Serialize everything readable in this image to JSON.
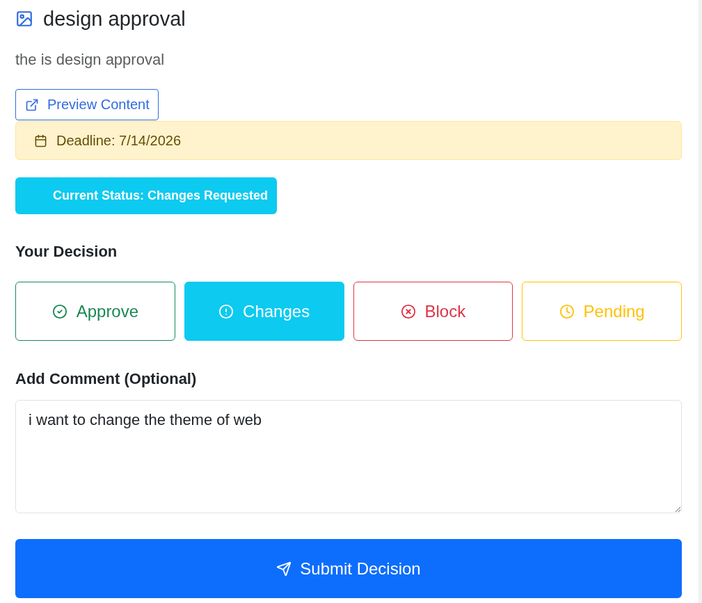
{
  "header": {
    "title": "design approval",
    "description": "the is design approval"
  },
  "preview_button": {
    "label": "Preview Content"
  },
  "deadline": {
    "text": "Deadline: 7/14/2026"
  },
  "status": {
    "text": "Current Status: Changes Requested"
  },
  "decision": {
    "heading": "Your Decision",
    "options": [
      {
        "kind": "approve",
        "label": "Approve",
        "color": "#198754",
        "selected": false
      },
      {
        "kind": "changes",
        "label": "Changes",
        "color": "#0dcaf0",
        "selected": true
      },
      {
        "kind": "block",
        "label": "Block",
        "color": "#dc3545",
        "selected": false
      },
      {
        "kind": "pending",
        "label": "Pending",
        "color": "#ffc107",
        "selected": false
      }
    ]
  },
  "comment": {
    "heading": "Add Comment (Optional)",
    "value": "i want to change the theme of web"
  },
  "submit_button": {
    "label": "Submit Decision"
  }
}
